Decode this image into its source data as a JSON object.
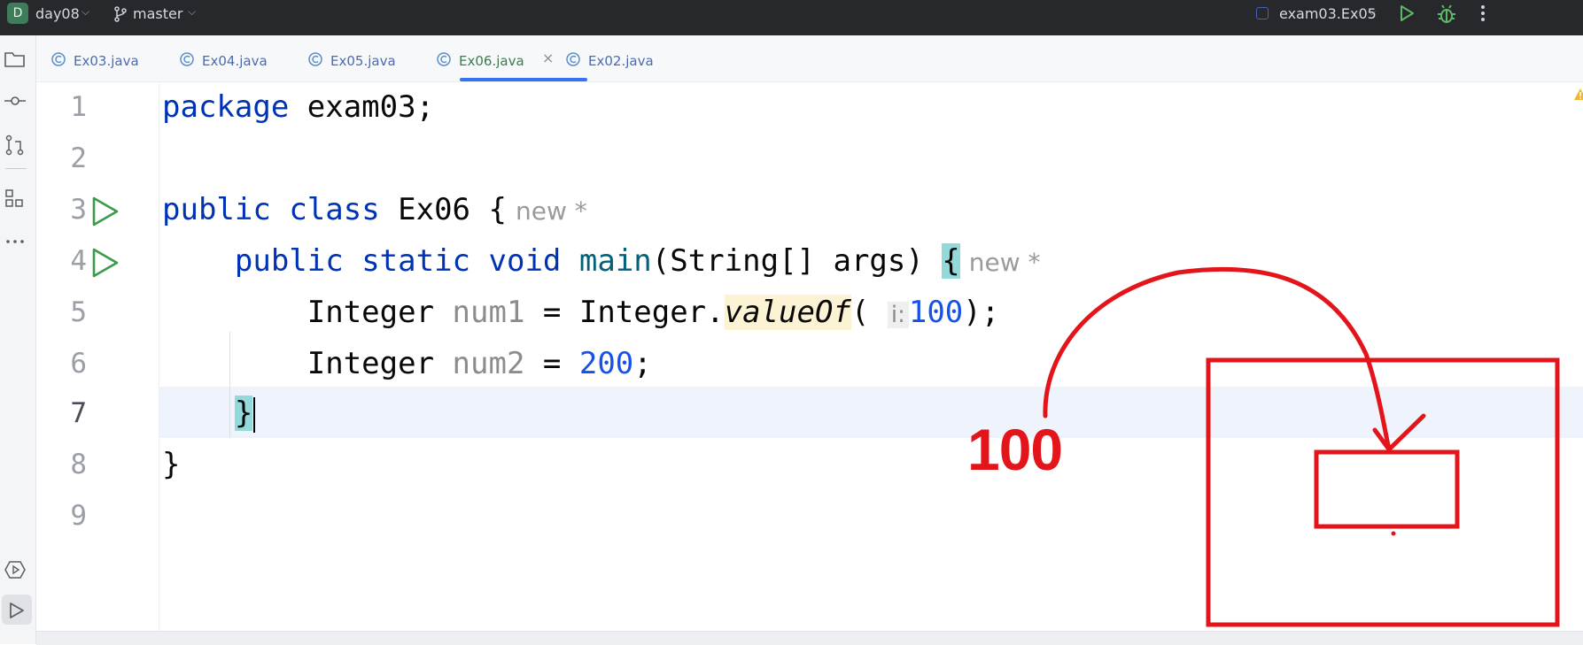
{
  "titlebar": {
    "project_badge": "D",
    "project_name": "day08",
    "branch_name": "master",
    "run_config": "exam03.Ex05",
    "icons": [
      "chevron-down-icon",
      "branch-icon",
      "run-icon",
      "debug-icon",
      "more-icon"
    ]
  },
  "toolstrip": {
    "icons": [
      "folder-icon",
      "commit-icon",
      "pull-request-icon",
      "structure-icon",
      "more-icon",
      "services-icon",
      "run-tool-icon"
    ]
  },
  "tabs": [
    {
      "label": "Ex03.java"
    },
    {
      "label": "Ex04.java"
    },
    {
      "label": "Ex05.java"
    },
    {
      "label": "Ex06.java",
      "close": "×"
    },
    {
      "label": "Ex02.java"
    }
  ],
  "active_tab_index": 3,
  "editor": {
    "line_numbers": [
      "1",
      "2",
      "3",
      "4",
      "5",
      "6",
      "7",
      "8",
      "9"
    ],
    "line1": {
      "kw": "package",
      "rest": " exam03;"
    },
    "line3": {
      "kw_public": "public",
      "kw_class": "class",
      "name": " Ex06 {",
      "hint": "new *"
    },
    "line4": {
      "kw_public": "public",
      "kw_static": "static",
      "kw_void": "void",
      "method": "main",
      "params": "(String[] args) ",
      "brace": "{",
      "hint": "new *"
    },
    "line5": {
      "type": "Integer",
      "var": "num1",
      "eq": " = Integer.",
      "call": "valueOf",
      "open": "(",
      "param_hint": "i:",
      "value": "100",
      "close": ");"
    },
    "line6": {
      "type": "Integer",
      "var": "num2",
      "eq": " = ",
      "value": "200",
      "close": ";"
    },
    "line7": {
      "brace": "}"
    },
    "line8": {
      "brace": "}"
    }
  },
  "annotation": {
    "label": "100",
    "color": "#e3151b"
  },
  "colors": {
    "keyword": "#0033b3",
    "number": "#1750eb",
    "method": "#00627a",
    "run_gutter": "#3b9b4a",
    "tab_active_underline": "#3574f0"
  }
}
